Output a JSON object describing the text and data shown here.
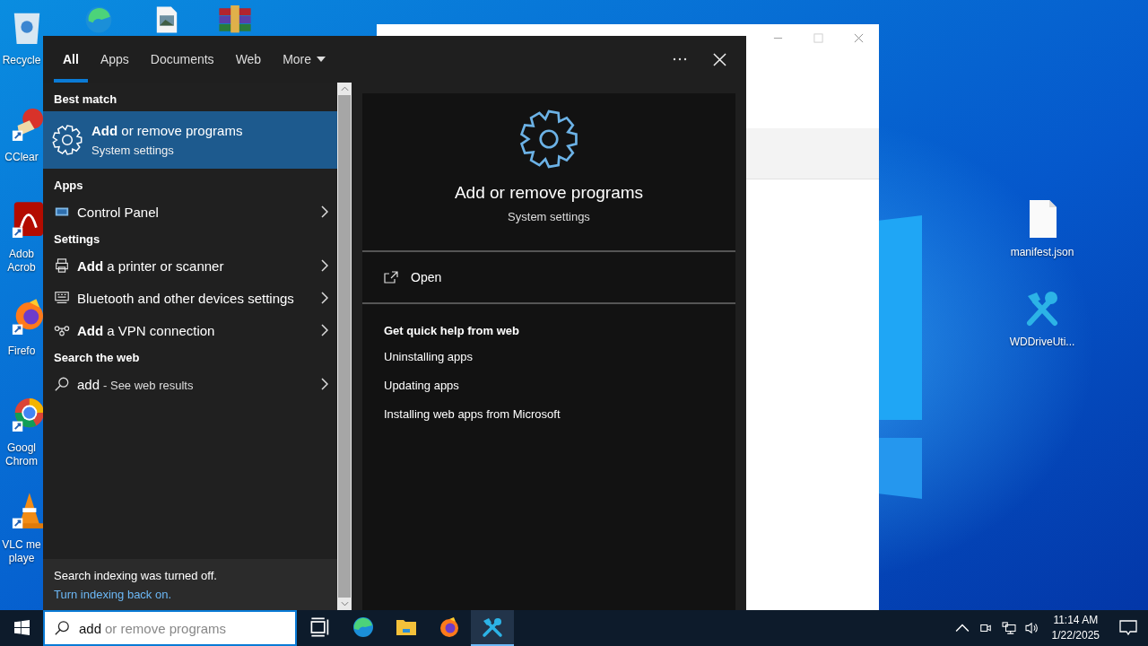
{
  "desktop": {
    "left_icons": [
      {
        "lines": [
          "Recycle"
        ]
      },
      {
        "lines": [
          "CClear"
        ]
      },
      {
        "lines": [
          "Adob",
          "Acrob"
        ]
      },
      {
        "lines": [
          "Firefo"
        ]
      },
      {
        "lines": [
          "Googl",
          "Chrom"
        ]
      },
      {
        "lines": [
          "VLC me",
          "playe"
        ]
      }
    ],
    "right_icons": [
      {
        "label": "manifest.json"
      },
      {
        "label": "WDDriveUti..."
      }
    ]
  },
  "search_panel": {
    "tabs": [
      {
        "label": "All",
        "selected": true
      },
      {
        "label": "Apps",
        "selected": false
      },
      {
        "label": "Documents",
        "selected": false
      },
      {
        "label": "Web",
        "selected": false
      },
      {
        "label": "More",
        "selected": false
      }
    ],
    "best_match": {
      "header": "Best match",
      "title": "**Add** or remove programs",
      "subtitle": "System settings",
      "selected": true
    },
    "groups": [
      {
        "header": "Apps",
        "items": [
          {
            "label": "Control Panel"
          }
        ]
      },
      {
        "header": "Settings",
        "items": [
          {
            "label": "**Add** a printer or scanner"
          },
          {
            "label": "Bluetooth and other devices settings"
          },
          {
            "label": "**Add** a VPN connection"
          }
        ]
      },
      {
        "header": "Search the web",
        "items": [
          {
            "label": "add",
            "suffix": "- See web results"
          }
        ]
      }
    ],
    "footer": {
      "message": "Search indexing was turned off.",
      "link": "Turn indexing back on."
    },
    "preview": {
      "title": "Add or remove programs",
      "subtitle": "System settings",
      "actions": [
        "Open"
      ],
      "help_header": "Get quick help from web",
      "help_links": [
        "Uninstalling apps",
        "Updating apps",
        "Installing web apps from Microsoft"
      ]
    }
  },
  "taskbar": {
    "search": {
      "value": "add",
      "suggestion": "or remove programs"
    },
    "pinned": [
      {
        "active": false
      },
      {
        "active": false
      },
      {
        "active": false
      },
      {
        "active": false
      },
      {
        "active": true
      }
    ],
    "clock": {
      "time": "11:14 AM",
      "date": "1/22/2025"
    }
  }
}
